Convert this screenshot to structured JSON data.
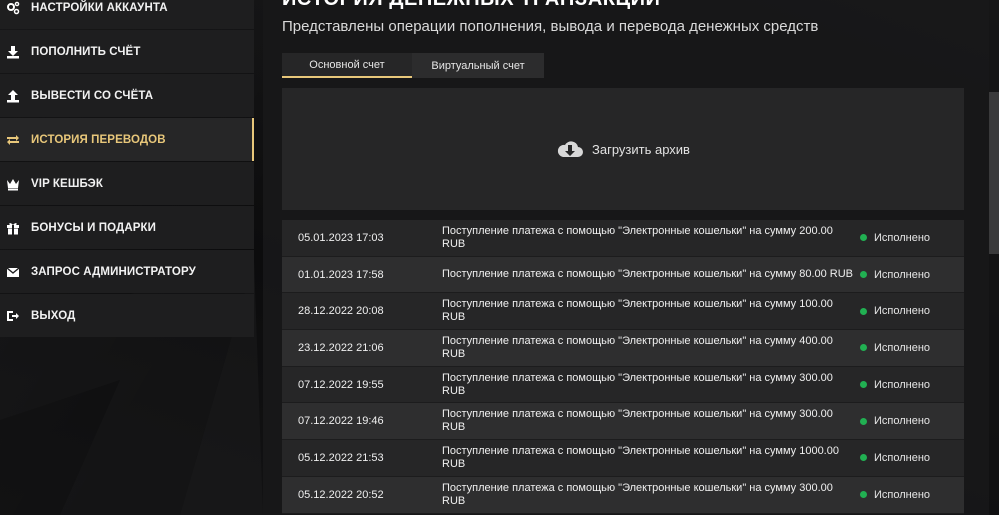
{
  "sidebar": {
    "items": [
      {
        "label": "НАСТРОЙКИ АККАУНТА",
        "icon": "gears-icon"
      },
      {
        "label": "ПОПОЛНИТЬ СЧЁТ",
        "icon": "download-icon"
      },
      {
        "label": "ВЫВЕСТИ СО СЧЁТА",
        "icon": "upload-icon"
      },
      {
        "label": "ИСТОРИЯ ПЕРЕВОДОВ",
        "icon": "transfer-arrows-icon",
        "active": true
      },
      {
        "label": "VIP КЕШБЭК",
        "icon": "crown-icon"
      },
      {
        "label": "БОНУСЫ И ПОДАРКИ",
        "icon": "gift-icon"
      },
      {
        "label": "ЗАПРОС АДМИНИСТРАТОРУ",
        "icon": "envelope-icon"
      },
      {
        "label": "ВЫХОД",
        "icon": "logout-icon"
      }
    ]
  },
  "main": {
    "title": "ИСТОРИЯ ДЕНЕЖНЫХ ТРАНЗАКЦИЙ",
    "subtitle": "Представлены операции пополнения, вывода и перевода денежных средств",
    "tabs": [
      {
        "label": "Основной счет",
        "active": true
      },
      {
        "label": "Виртуальный счет",
        "active": false
      }
    ],
    "upload_label": "Загрузить архив",
    "transactions": [
      {
        "date": "05.01.2023 17:03",
        "desc": "Поступление платежа с помощью \"Электронные кошельки\" на сумму 200.00 RUB",
        "status": "Исполнено"
      },
      {
        "date": "01.01.2023 17:58",
        "desc": "Поступление платежа с помощью \"Электронные кошельки\" на сумму 80.00 RUB",
        "status": "Исполнено"
      },
      {
        "date": "28.12.2022 20:08",
        "desc": "Поступление платежа с помощью \"Электронные кошельки\" на сумму 100.00 RUB",
        "status": "Исполнено"
      },
      {
        "date": "23.12.2022 21:06",
        "desc": "Поступление платежа с помощью \"Электронные кошельки\" на сумму 400.00 RUB",
        "status": "Исполнено"
      },
      {
        "date": "07.12.2022 19:55",
        "desc": "Поступление платежа с помощью \"Электронные кошельки\" на сумму 300.00 RUB",
        "status": "Исполнено"
      },
      {
        "date": "07.12.2022 19:46",
        "desc": "Поступление платежа с помощью \"Электронные кошельки\" на сумму 300.00 RUB",
        "status": "Исполнено"
      },
      {
        "date": "05.12.2022 21:53",
        "desc": "Поступление платежа с помощью \"Электронные кошельки\" на сумму 1000.00 RUB",
        "status": "Исполнено"
      },
      {
        "date": "05.12.2022 20:52",
        "desc": "Поступление платежа с помощью \"Электронные кошельки\" на сумму 300.00 RUB",
        "status": "Исполнено"
      }
    ]
  },
  "colors": {
    "accent": "#e8c77a",
    "status_success": "#21b052"
  }
}
